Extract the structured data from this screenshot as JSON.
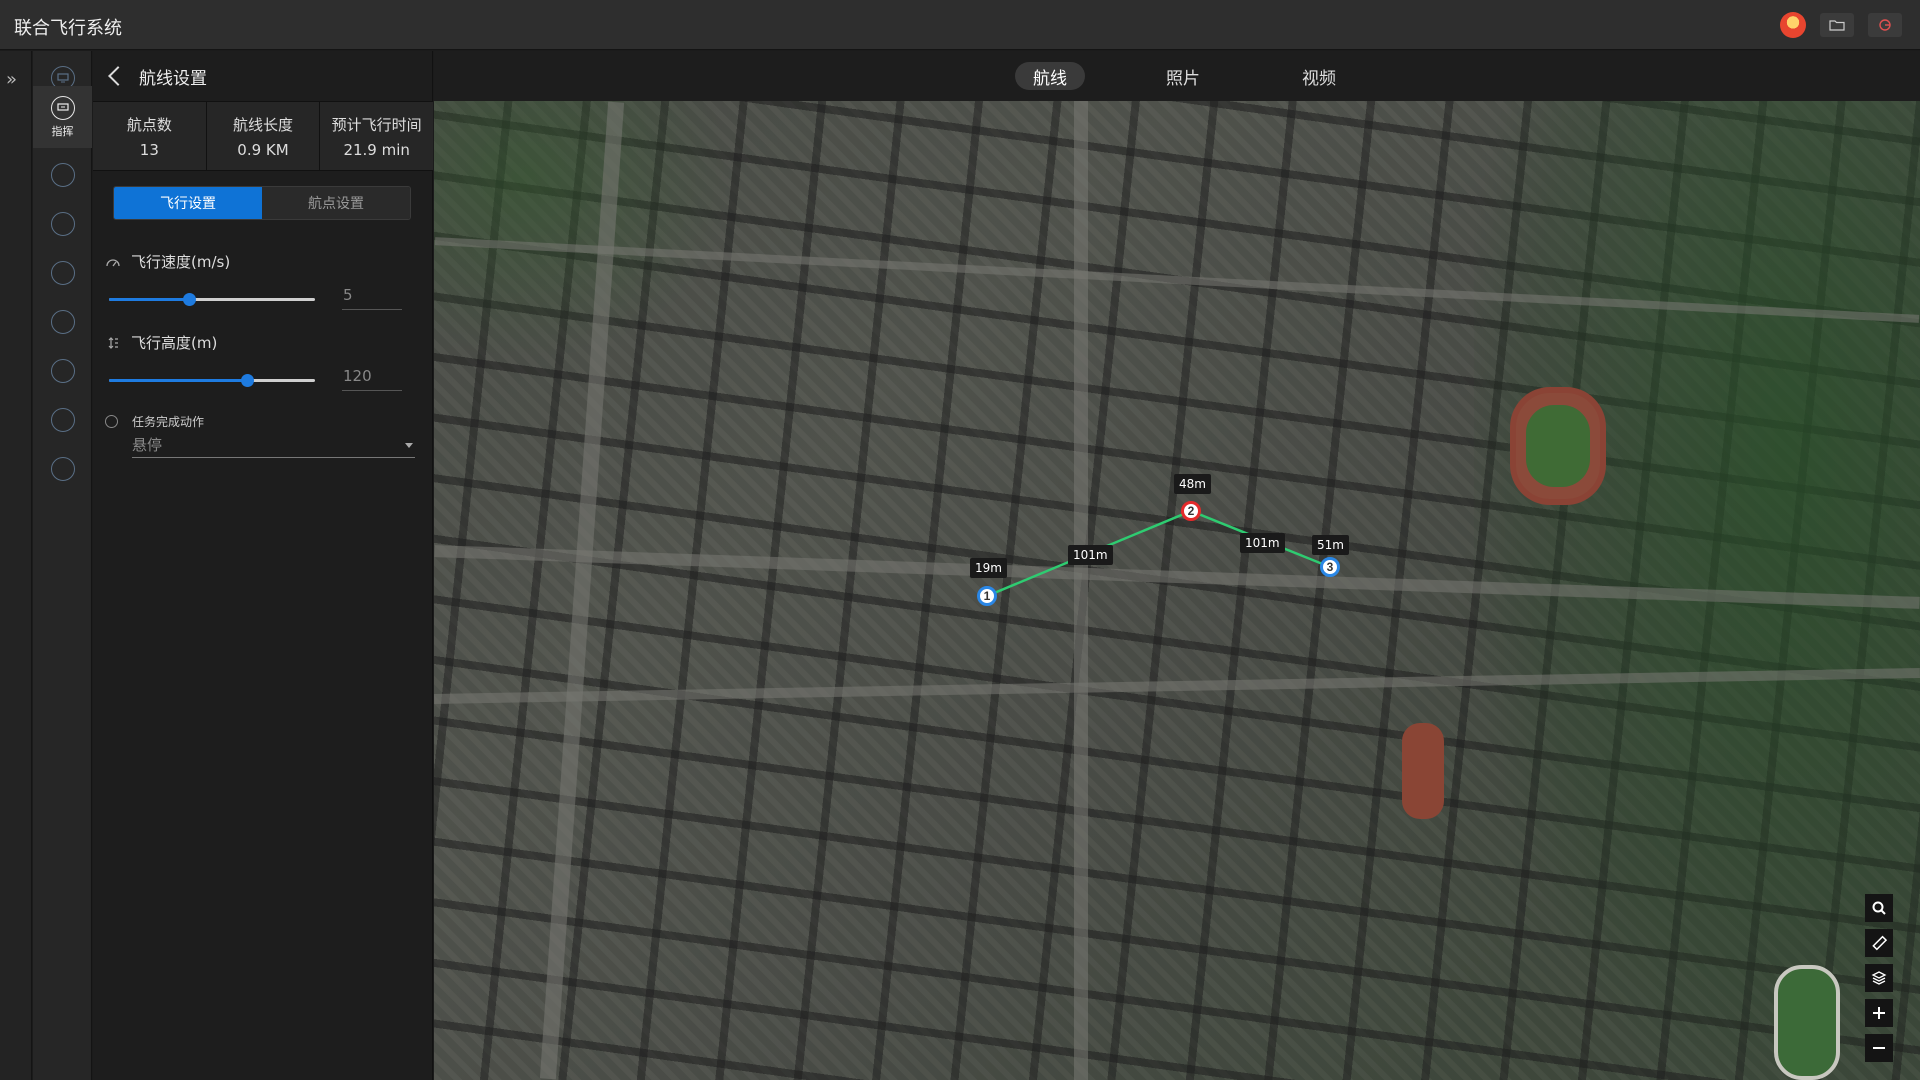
{
  "app": {
    "title": "联合飞行系统"
  },
  "nav": {
    "active_label": "指挥"
  },
  "panel": {
    "title": "航线设置",
    "stats": [
      {
        "label": "航点数",
        "value": "13"
      },
      {
        "label": "航线长度",
        "value": "0.9 KM"
      },
      {
        "label": "预计飞行时间",
        "value": "21.9 min"
      }
    ],
    "tabs": [
      {
        "label": "飞行设置"
      },
      {
        "label": "航点设置"
      }
    ],
    "speed": {
      "label": "飞行速度(m/s)",
      "value": "5",
      "level": 0.39
    },
    "height": {
      "label": "飞行高度(m)",
      "value": "120",
      "level": 0.67
    },
    "finish_action": {
      "label": "任务完成动作",
      "value": "悬停"
    }
  },
  "top_tabs": [
    {
      "label": "航线"
    },
    {
      "label": "照片"
    },
    {
      "label": "视频"
    }
  ],
  "map": {
    "waypoints": [
      {
        "label": "1"
      },
      {
        "label": "2"
      },
      {
        "label": "3"
      }
    ],
    "labels": {
      "wp1_alt": "19m",
      "seg1": "101m",
      "wp2_alt": "48m",
      "seg2": "101m",
      "wp3_alt": "51m"
    }
  },
  "colors": {
    "accent": "#0f73d6",
    "route": "#2ecc71",
    "waypoint_blue": "#2a87e6",
    "waypoint_red": "#e42a2a"
  }
}
